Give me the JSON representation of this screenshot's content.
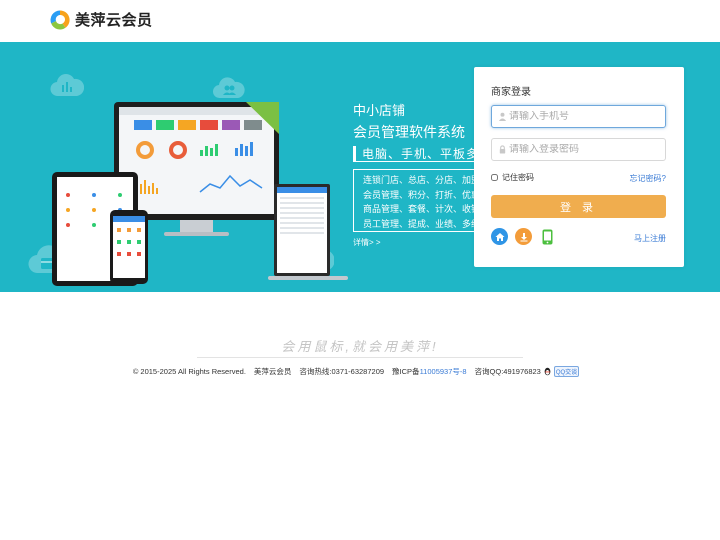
{
  "header": {
    "brand": "美萍云会员"
  },
  "promo": {
    "subtitle": "中小店铺",
    "title": "会员管理软件系统",
    "tagline": "电脑、手机、平板多终端",
    "features": [
      "连锁门店、总店、分店、加盟店",
      "会员管理、积分、打折、优惠",
      "商品管理、套餐、计次、收银",
      "员工管理、提成、业绩、多级"
    ],
    "more_link": "详情> >"
  },
  "login": {
    "title": "商家登录",
    "phone_placeholder": "请输入手机号",
    "password_placeholder": "请输入登录密码",
    "remember_label": "记住密码",
    "forgot_link": "忘记密码?",
    "submit_label": "登 录",
    "register_link": "马上注册",
    "icons": [
      "home-icon",
      "download-icon",
      "mobile-icon"
    ]
  },
  "colors": {
    "banner": "#1fb6c6",
    "button": "#f0ad4e",
    "link": "#3a7bd5",
    "icon_home": "#2f95e6",
    "icon_download": "#f39c3a",
    "icon_mobile": "#4cbf3f"
  },
  "footer": {
    "slogan": "会用鼠标,就会用美萍!",
    "copyright": "© 2015-2025 All Rights Reserved.",
    "brand": "美萍云会员",
    "hotline": "咨询热线:0371-63287209",
    "icp_prefix": "豫ICP备",
    "icp_number": "11005937号-8",
    "qq": "咨询QQ:491976823",
    "qq_badge": "QQ交谈"
  }
}
